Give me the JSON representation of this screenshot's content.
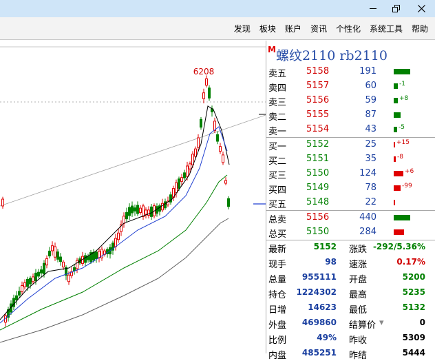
{
  "window": {
    "minimize_icon": "minimize-icon",
    "maximize_icon": "restore-icon",
    "close_icon": "close-icon"
  },
  "menu": [
    "发现",
    "板块",
    "账户",
    "资讯",
    "个性化",
    "系统工具",
    "帮助"
  ],
  "chart": {
    "high_label": "6208",
    "colors": {
      "up": "#e00000",
      "down": "#008000",
      "ma_black": "#000000",
      "ma_blue": "#1f3fd0",
      "ma_green": "#008000",
      "ma_gray": "#606060"
    }
  },
  "quote": {
    "badge": "M",
    "title": "螺纹2110 rb2110",
    "sell": [
      {
        "label": "卖五",
        "price": "5158",
        "vol": "191",
        "chg": ""
      },
      {
        "label": "卖四",
        "price": "5157",
        "vol": "60",
        "chg": "-1"
      },
      {
        "label": "卖三",
        "price": "5156",
        "vol": "59",
        "chg": "+8"
      },
      {
        "label": "卖二",
        "price": "5155",
        "vol": "87",
        "chg": ""
      },
      {
        "label": "卖一",
        "price": "5154",
        "vol": "43",
        "chg": "-5"
      }
    ],
    "buy": [
      {
        "label": "买一",
        "price": "5152",
        "vol": "25",
        "chg": "+15"
      },
      {
        "label": "买二",
        "price": "5151",
        "vol": "35",
        "chg": "-8"
      },
      {
        "label": "买三",
        "price": "5150",
        "vol": "124",
        "chg": "+6"
      },
      {
        "label": "买四",
        "price": "5149",
        "vol": "78",
        "chg": "-99"
      },
      {
        "label": "买五",
        "price": "5148",
        "vol": "22",
        "chg": ""
      }
    ],
    "totals": [
      {
        "label": "总卖",
        "price": "5156",
        "vol": "440"
      },
      {
        "label": "总买",
        "price": "5150",
        "vol": "284"
      }
    ],
    "stats": [
      {
        "l1": "最新",
        "v1": "5152",
        "l2": "涨跌",
        "v2": "-292/5.36%"
      },
      {
        "l1": "现手",
        "v1": "98",
        "l2": "速涨",
        "v2": "0.17%"
      },
      {
        "l1": "总量",
        "v1": "955111",
        "l2": "开盘",
        "v2": "5200"
      },
      {
        "l1": "持仓",
        "v1": "1224302",
        "l2": "最高",
        "v2": "5235"
      },
      {
        "l1": "日增",
        "v1": "14623",
        "l2": "最低",
        "v2": "5132"
      },
      {
        "l1": "外盘",
        "v1": "469860",
        "l2": "结算价",
        "v2": "0"
      },
      {
        "l1": "比例",
        "v1": "49%",
        "l2": "昨收",
        "v2": "5309"
      },
      {
        "l1": "内盘",
        "v1": "485251",
        "l2": "昨结",
        "v2": "5444"
      }
    ]
  }
}
